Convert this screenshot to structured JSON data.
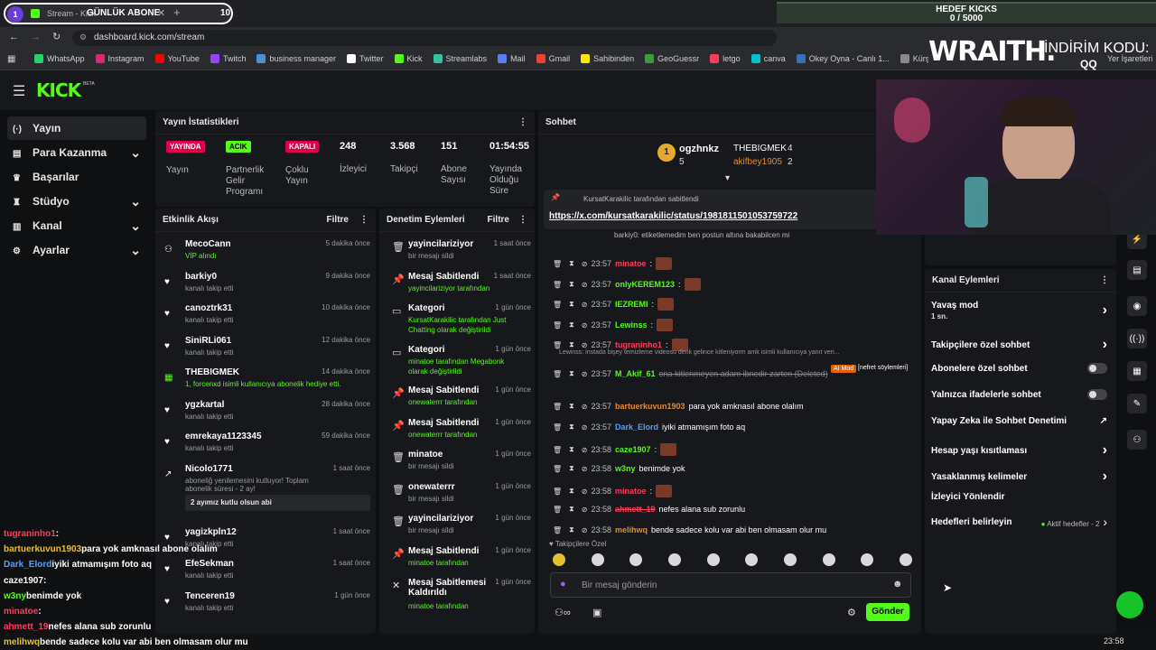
{
  "browser": {
    "tab_count_badge": "1",
    "tab_title": "Stream - Kick",
    "overlay_tag": "GÜNLÜK ABONE",
    "overlay_count": "10",
    "url": "dashboard.kick.com/stream",
    "bookmarks": [
      "WhatsApp",
      "Instagram",
      "YouTube",
      "Twitch",
      "business manager",
      "Twitter",
      "Kick",
      "Streamlabs",
      "Mail",
      "Gmail",
      "Sahibinden",
      "GeoGuessr",
      "letgo",
      "canva",
      "Okey Oyna - Canlı 1...",
      "Kürşat Karakılıç (@k..."
    ],
    "bookmarks_end": "Yer İşaretleri"
  },
  "stream_overlay": {
    "goal_title": "HEDEF KICKS",
    "goal_value": "0 / 5000",
    "sponsor": "WRAITH.",
    "discount_label": "İNDİRİM KODU:",
    "discount_code": "QQ"
  },
  "nav": {
    "logo": "KICK",
    "logo_sup": "BETA",
    "items": [
      {
        "label": "Yayın",
        "active": true
      },
      {
        "label": "Para Kazanma"
      },
      {
        "label": "Başarılar"
      },
      {
        "label": "Stüdyo"
      },
      {
        "label": "Kanal"
      },
      {
        "label": "Ayarlar"
      }
    ]
  },
  "stats": {
    "title": "Yayın İstatistikleri",
    "cells": [
      {
        "badge": "YAYINDA",
        "label": "Yayın"
      },
      {
        "badge": "ACIK",
        "label": "Partnerlik Gelir Programı"
      },
      {
        "badge": "KAPALI",
        "label": "Çoklu Yayın"
      },
      {
        "value": "248",
        "label": "İzleyici"
      },
      {
        "value": "3.568",
        "label": "Takipçi"
      },
      {
        "value": "151",
        "label": "Abone Sayısı"
      },
      {
        "value": "01:54:55",
        "label": "Yayında Olduğu Süre"
      }
    ]
  },
  "activity": {
    "title": "Etkinlik Akışı",
    "filter": "Filtre",
    "items": [
      {
        "name": "MecoCann",
        "sub": "VİP alındı",
        "time": "5 dakika önce"
      },
      {
        "name": "barkiy0",
        "sub": "kanalı takip etti",
        "time": "9 dakika önce"
      },
      {
        "name": "canoztrk31",
        "sub": "kanalı takip etti",
        "time": "10 dakika önce"
      },
      {
        "name": "SiniRLi061",
        "sub": "kanalı takip etti",
        "time": "12 dakika önce"
      },
      {
        "name": "THEBIGMEK",
        "sub": "1, forcenxd isimli kullanıcıya abonelik hediye etti.",
        "time": "14 dakika önce"
      },
      {
        "name": "ygzkartal",
        "sub": "kanalı takip etti",
        "time": "28 dakika önce"
      },
      {
        "name": "emrekaya1123345",
        "sub": "kanalı takip etti",
        "time": "59 dakika önce"
      },
      {
        "name": "Nicolo1771",
        "sub": "aboneliğ yenilemesini kutluyor! Toplam abonelik süresi - 2 ay!",
        "time": "1 saat önce",
        "msg": "2 ayımız kutlu olsun abi"
      },
      {
        "name": "yagizkpln12",
        "sub": "kanalı takip etti",
        "time": "1 saat önce"
      },
      {
        "name": "EfeSekman",
        "sub": "kanalı takip etti",
        "time": "1 saat önce"
      },
      {
        "name": "Tenceren19",
        "sub": "kanalı takip etti",
        "time": "1 gün önce"
      }
    ]
  },
  "moderation": {
    "title": "Denetim Eylemleri",
    "filter": "Filtre",
    "items": [
      {
        "name": "yayincilariziyor",
        "sub": "bir mesajı sildi",
        "time": "1 saat önce"
      },
      {
        "name": "Mesaj Sabitlendi",
        "sub": "yayincilariziyor tarafından",
        "time": "1 saat önce"
      },
      {
        "name": "Kategori",
        "sub": "KursatKarakilic tarafından Just Chatting olarak değiştirildi",
        "time": "1 gün önce"
      },
      {
        "name": "Kategori",
        "sub": "minatoe tarafından Megabonk olarak değiştirildi",
        "time": "1 gün önce"
      },
      {
        "name": "Mesaj Sabitlendi",
        "sub": "onewaterrr tarafından",
        "time": "1 gün önce"
      },
      {
        "name": "Mesaj Sabitlendi",
        "sub": "onewaterrr tarafından",
        "time": "1 gün önce"
      },
      {
        "name": "minatoe",
        "sub": "bir mesajı sildi",
        "time": "1 gün önce"
      },
      {
        "name": "onewaterrr",
        "sub": "bir mesajı sildi",
        "time": "1 gün önce"
      },
      {
        "name": "yayincilariziyor",
        "sub": "bir mesajı sildi",
        "time": "1 gün önce"
      },
      {
        "name": "Mesaj Sabitlendi",
        "sub": "minatoe tarafından",
        "time": "1 gün önce"
      },
      {
        "name": "Mesaj Sabitlemesi Kaldırıldı",
        "sub": "minatoe tarafından",
        "time": "1 gün önce"
      }
    ]
  },
  "chat": {
    "title": "Sohbet",
    "top_gifters": [
      {
        "rank": "1",
        "name": "ogzhnkz",
        "count": "5"
      },
      {
        "rank": "",
        "name": "THEBIGMEK",
        "count": "4"
      },
      {
        "rank": "",
        "name": "akifbey1905",
        "count": "2"
      }
    ],
    "pinned_by": "KursatKarakilic tarafından sabitlendi",
    "pinned_link": "https://x.com/kursatkarakilic/status/1981811501053759722",
    "pinned_under": "barkiy0: etiketlemedim ben postun altına bakabilcen mi",
    "messages": [
      {
        "time": "23:57",
        "user": "barkiy0",
        "text": ":"
      },
      {
        "time": "23:57",
        "user": "minatoe",
        "text": ":"
      },
      {
        "time": "23:57",
        "user": "onlyKEREM123",
        "text": ":"
      },
      {
        "time": "23:57",
        "user": "IEZREMI",
        "text": ":"
      },
      {
        "time": "23:57",
        "user": "Lewinss",
        "text": ":"
      },
      {
        "time": "23:57",
        "user": "tugraninho1",
        "text": ":"
      },
      {
        "time": "23:57",
        "user": "M_Akif_61",
        "text": "ona kitlenmeyen adam ibnedir zarten (Deleted)"
      },
      {
        "time": "23:57",
        "user": "bartuerkuvun1903",
        "text": "para yok amknasıl abone olalım"
      },
      {
        "time": "23:57",
        "user": "Dark_Elord",
        "text": "iyiki atmamışım foto aq"
      },
      {
        "time": "23:58",
        "user": "caze1907",
        "text": ":"
      },
      {
        "time": "23:58",
        "user": "w3ny",
        "text": "benimde yok"
      },
      {
        "time": "23:58",
        "user": "minatoe",
        "text": ":"
      },
      {
        "time": "23:58",
        "user": "ahmett_19",
        "text": "nefes alana sub zorunlu"
      },
      {
        "time": "23:58",
        "user": "melihwq",
        "text": "bende sadece kolu var abi ben olmasam olur mu"
      }
    ],
    "reply_preview": "Lewinss: instada bişey temizleme videosu denk gelince kitleniyorm amk isimli kullanıcıya yanıt veri...",
    "ai_mod": "AI Mod",
    "ai_reason": "[nefret söylemleri]",
    "followers_only": "Takipçilere Özel",
    "input_placeholder": "Bir mesaj gönderin",
    "send": "Gönder"
  },
  "channel_actions": {
    "title": "Kanal Eylemleri",
    "slow_mode": "Yavaş mod",
    "slow_value": "1 sn.",
    "items": [
      "Takipçilere özel sohbet",
      "Abonelere özel sohbet",
      "Yalnızca ifadelerle sohbet",
      "Yapay Zeka ile Sohbet Denetimi",
      "Hesap yaşı kısıtlaması",
      "Yasaklanmış kelimeler",
      "İzleyici Yönlendir",
      "Hedefleri belirleyin"
    ],
    "goals_status": "Aktif hedefler - 2"
  },
  "chat_overlay": [
    {
      "user": "tugraninho1",
      "text": ":"
    },
    {
      "user": "bartuerkuvun1903",
      "text": "para yok amknasıl abone olalım"
    },
    {
      "user": "Dark_Elord",
      "text": "iyiki atmamışım foto aq"
    },
    {
      "user": "caze1907",
      "text": ":"
    },
    {
      "user": "w3ny",
      "text": "benimde yok"
    },
    {
      "user": "minatoe",
      "text": ":"
    },
    {
      "user": "ahmett_19",
      "text": "nefes alana sub zorunlu"
    },
    {
      "user": "melihwq",
      "text": "bende sadece kolu var abi ben olmasam olur mu"
    }
  ],
  "taskbar": {
    "clock": "23:58"
  },
  "colors": {
    "kick_green": "#53fc18",
    "live_red": "#e0004a",
    "panel": "#17181b"
  }
}
